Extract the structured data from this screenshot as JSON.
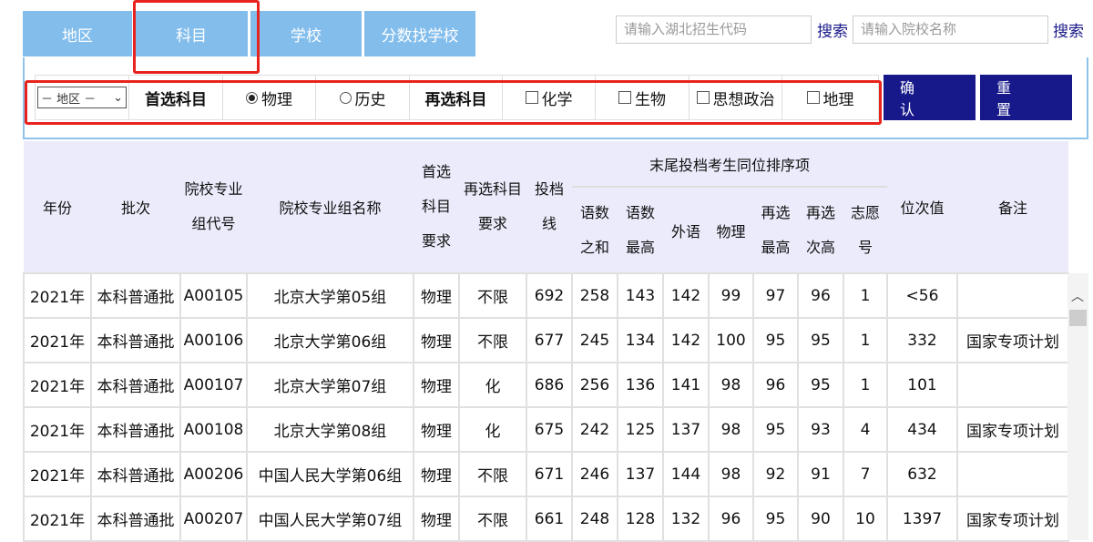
{
  "tabs": [
    "地区",
    "科目",
    "学校",
    "分数找学校"
  ],
  "search": {
    "code_placeholder": "请输入湖北招生代码",
    "name_placeholder": "请输入院校名称",
    "search_label": "搜索"
  },
  "filter": {
    "region_select": "－ 地区 －",
    "first_label": "首选科目",
    "first_options": [
      "物理",
      "历史"
    ],
    "first_selected": "物理",
    "second_label": "再选科目",
    "second_options": [
      "化学",
      "生物",
      "思想政治",
      "地理"
    ],
    "confirm": "确 认",
    "reset": "重 置"
  },
  "table": {
    "headers": {
      "year": "年份",
      "batch": "批次",
      "code": [
        "院校专业",
        "组代号"
      ],
      "name": "院校专业组名称",
      "first": [
        "首选",
        "科目",
        "要求"
      ],
      "second": [
        "再选科目",
        "要求"
      ],
      "score": [
        "投档",
        "线"
      ],
      "group": "末尾投档考生同位排序项",
      "sub": [
        [
          "语数",
          "之和"
        ],
        [
          "语数",
          "最高"
        ],
        [
          "外语"
        ],
        [
          "物理"
        ],
        [
          "再选",
          "最高"
        ],
        [
          "再选",
          "次高"
        ],
        [
          "志愿",
          "号"
        ]
      ],
      "rank": "位次值",
      "note": "备注"
    },
    "rows": [
      [
        "2021年",
        "本科普通批",
        "A00105",
        "北京大学第05组",
        "物理",
        "不限",
        "692",
        "258",
        "143",
        "142",
        "99",
        "97",
        "96",
        "1",
        "<56",
        ""
      ],
      [
        "2021年",
        "本科普通批",
        "A00106",
        "北京大学第06组",
        "物理",
        "不限",
        "677",
        "245",
        "134",
        "142",
        "100",
        "95",
        "95",
        "1",
        "332",
        "国家专项计划"
      ],
      [
        "2021年",
        "本科普通批",
        "A00107",
        "北京大学第07组",
        "物理",
        "化",
        "686",
        "256",
        "136",
        "141",
        "98",
        "96",
        "95",
        "1",
        "101",
        ""
      ],
      [
        "2021年",
        "本科普通批",
        "A00108",
        "北京大学第08组",
        "物理",
        "化",
        "675",
        "242",
        "125",
        "137",
        "98",
        "95",
        "93",
        "4",
        "434",
        "国家专项计划"
      ],
      [
        "2021年",
        "本科普通批",
        "A00206",
        "中国人民大学第06组",
        "物理",
        "不限",
        "671",
        "246",
        "137",
        "144",
        "98",
        "92",
        "91",
        "7",
        "632",
        ""
      ],
      [
        "2021年",
        "本科普通批",
        "A00207",
        "中国人民大学第07组",
        "物理",
        "不限",
        "661",
        "248",
        "128",
        "132",
        "96",
        "95",
        "90",
        "10",
        "1397",
        "国家专项计划"
      ]
    ]
  }
}
